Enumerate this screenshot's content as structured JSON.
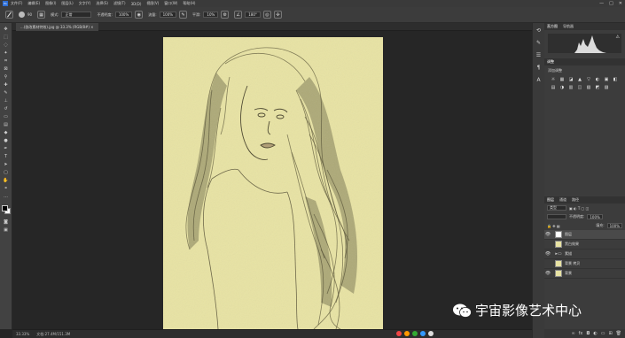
{
  "menubar": {
    "items": [
      "文件(F)",
      "编辑(E)",
      "图像(I)",
      "图层(L)",
      "文字(Y)",
      "选择(S)",
      "滤镜(T)",
      "3D(D)",
      "视图(V)",
      "窗口(W)",
      "帮助(H)"
    ],
    "win_controls": [
      "—",
      "□",
      "✕"
    ]
  },
  "options": {
    "brush_size": "90",
    "mode_label": "模式:",
    "mode_value": "正常",
    "opacity_label": "不透明度:",
    "opacity_value": "100%",
    "flow_label": "流量:",
    "flow_value": "100%",
    "smooth_label": "平滑:",
    "smooth_value": "10%",
    "angle_value": "180°"
  },
  "tab": {
    "label": "...(欲改素材特效).jpg @ 33.3% (RGB/8#) ×"
  },
  "status": {
    "zoom": "33.33%",
    "doc_info": "文档:27.4M/151.3M"
  },
  "panels": {
    "histogram_tabs": [
      "直方图",
      "导航器"
    ],
    "adjust_tabs": [
      "调整"
    ],
    "adjust_title": "添加调整",
    "adjust_icons": [
      "☼",
      "▦",
      "◪",
      "▲",
      "▽",
      "◐",
      "▣",
      "◧",
      "▤",
      "◑",
      "▥",
      "◫",
      "▧",
      "◩",
      "▨"
    ],
    "layers_tabs": [
      "图层",
      "通道",
      "路径"
    ],
    "layers_kind": "类型",
    "layers_opacity_label": "不透明度:",
    "layers_opacity": "100%",
    "layers_fill_label": "填充:",
    "layers_fill": "100%",
    "layers": [
      {
        "name": "图层",
        "type": "pixel",
        "selected": true
      },
      {
        "name": "黑白效果",
        "type": "pixel",
        "selected": false
      },
      {
        "name": "素描",
        "type": "folder",
        "selected": false
      },
      {
        "name": "背景 拷贝",
        "type": "pixel",
        "selected": false
      },
      {
        "name": "背景",
        "type": "pixel",
        "selected": false
      }
    ]
  },
  "watermark": {
    "text": "宇宙影像艺术中心"
  }
}
